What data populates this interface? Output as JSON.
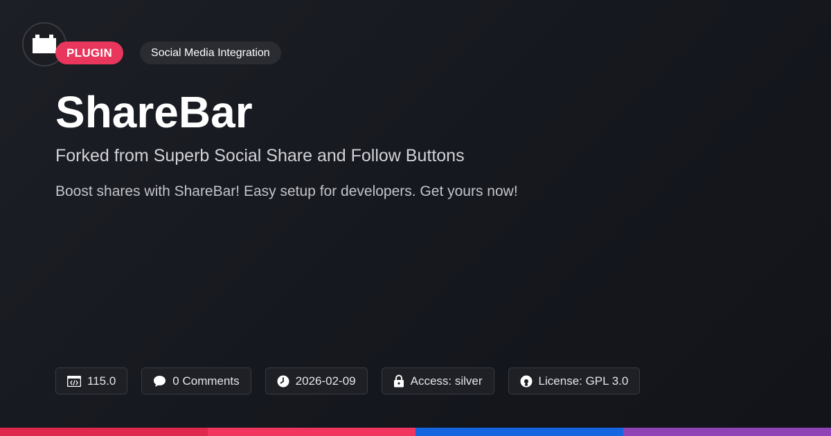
{
  "badges": {
    "type": "PLUGIN",
    "category": "Social Media Integration"
  },
  "title": "ShareBar",
  "subtitle": "Forked from Superb Social Share and Follow Buttons",
  "description": "Boost shares with ShareBar! Easy setup for developers. Get yours now!",
  "meta": {
    "version": "115.0",
    "comments": "0 Comments",
    "date": "2026-02-09",
    "access": "Access: silver",
    "license": "License: GPL 3.0"
  },
  "icons": {
    "logo": "plugin-block-icon",
    "version": "code-window-icon",
    "comments": "speech-bubble-icon",
    "date": "clock-icon",
    "access": "lock-icon",
    "license": "open-source-icon"
  },
  "colors": {
    "plugin_badge": "#e8365d",
    "bar": [
      "#e0284f",
      "#f0365f",
      "#1565e0",
      "#8e44b4"
    ]
  }
}
